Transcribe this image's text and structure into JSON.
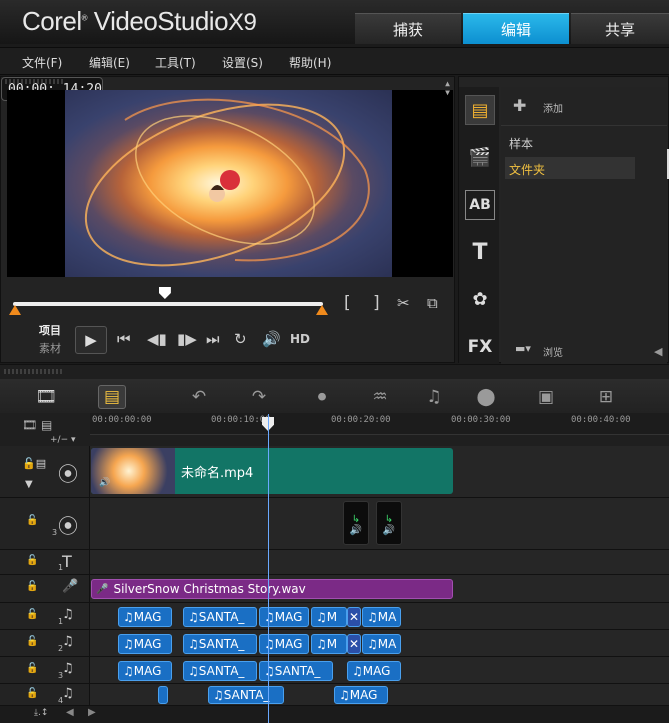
{
  "app": {
    "brand": "Corel",
    "product": "VideoStudio",
    "version": "X9"
  },
  "tabs": [
    {
      "label": "捕获"
    },
    {
      "label": "编辑",
      "active": true
    },
    {
      "label": "共享"
    }
  ],
  "menu": [
    "文件(F)",
    "编辑(E)",
    "工具(T)",
    "设置(S)",
    "帮助(H)"
  ],
  "player": {
    "mode_project": "项目",
    "mode_clip": "素材",
    "timecode": "00:00: 14:20",
    "hd": "HD",
    "mark_in": "[",
    "mark_out": "]",
    "scrub_position": 0.49
  },
  "library": {
    "add_label": "添加",
    "items": [
      "样本",
      "文件夹"
    ],
    "selected": "文件夹",
    "browse_label": "浏览",
    "fx_label": "FX"
  },
  "timeline": {
    "ruler": [
      "00:00:00:00",
      "00:00:10:00",
      "00:00:20:00",
      "00:00:30:00",
      "00:00:40:00"
    ],
    "video_clip": "未命名.mp4",
    "audio_clip": "SilverSnow Christmas Story.wav",
    "music_rows": [
      [
        "MAG",
        "SANTA_",
        "MAG",
        "M",
        "MA"
      ],
      [
        "MAG",
        "SANTA_",
        "MAG",
        "M",
        "MA"
      ],
      [
        "MAG",
        "SANTA_",
        "SANTA_",
        "MAG"
      ],
      [
        "SANTA_",
        "MAG"
      ]
    ],
    "track_numbers": [
      "3",
      "1",
      "1",
      "2",
      "3",
      "4"
    ]
  },
  "colors": {
    "accent": "#1aa3e0",
    "video_clip": "#127566",
    "voice_clip": "#7b2a86",
    "music_clip": "#1a6fc4"
  }
}
